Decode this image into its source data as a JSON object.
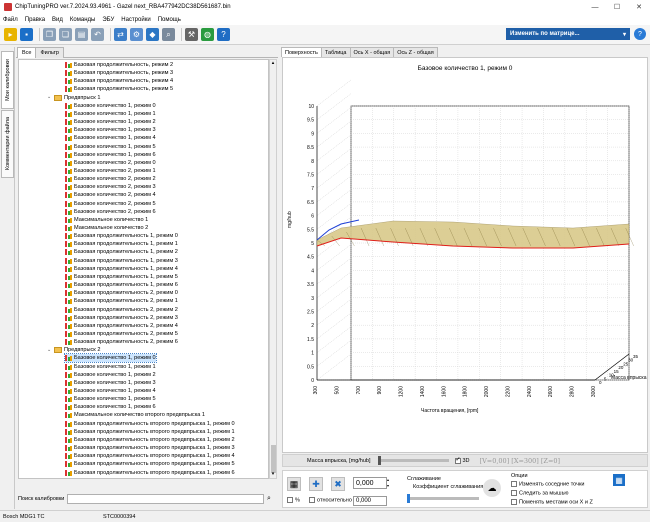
{
  "window": {
    "title": "ChipTuningPRO ver.7.2024.93.4961 - Gazel next_RBA477942DC38D561687.bin",
    "minimize": "—",
    "maximize": "☐",
    "close": "✕"
  },
  "menu": [
    "Файл",
    "Правка",
    "Вид",
    "Команды",
    "ЭБУ",
    "Настройки",
    "Помощь"
  ],
  "toolbar": {
    "matrix_button": "Изменить по матрице...",
    "help": "?"
  },
  "side_tabs": [
    "Мои калибровки",
    "Комментарии файла"
  ],
  "left_tabs": [
    "Все",
    "Фильтр"
  ],
  "tree": [
    {
      "type": "item",
      "indent": 2,
      "label": "Базовая продолжительность, режим 2"
    },
    {
      "type": "item",
      "indent": 2,
      "label": "Базовая продолжительность, режим 3"
    },
    {
      "type": "item",
      "indent": 2,
      "label": "Базовая продолжительность, режим 4"
    },
    {
      "type": "item",
      "indent": 2,
      "label": "Базовая продолжительность, режим 5"
    },
    {
      "type": "folder",
      "indent": 1,
      "label": "Предвпрыск 1"
    },
    {
      "type": "item",
      "indent": 2,
      "label": "Базовое количество 1, режим 0"
    },
    {
      "type": "item",
      "indent": 2,
      "label": "Базовое количество 1, режим 1"
    },
    {
      "type": "item",
      "indent": 2,
      "label": "Базовое количество 1, режим 2"
    },
    {
      "type": "item",
      "indent": 2,
      "label": "Базовое количество 1, режим 3"
    },
    {
      "type": "item",
      "indent": 2,
      "label": "Базовое количество 1, режим 4"
    },
    {
      "type": "item",
      "indent": 2,
      "label": "Базовое количество 1, режим 5"
    },
    {
      "type": "item",
      "indent": 2,
      "label": "Базовое количество 1, режим 6"
    },
    {
      "type": "item",
      "indent": 2,
      "label": "Базовое количество 2, режим 0"
    },
    {
      "type": "item",
      "indent": 2,
      "label": "Базовое количество 2, режим 1"
    },
    {
      "type": "item",
      "indent": 2,
      "label": "Базовое количество 2, режим 2"
    },
    {
      "type": "item",
      "indent": 2,
      "label": "Базовое количество 2, режим 3"
    },
    {
      "type": "item",
      "indent": 2,
      "label": "Базовое количество 2, режим 4"
    },
    {
      "type": "item",
      "indent": 2,
      "label": "Базовое количество 2, режим 5"
    },
    {
      "type": "item",
      "indent": 2,
      "label": "Базовое количество 2, режим 6"
    },
    {
      "type": "item",
      "indent": 2,
      "label": "Максимальное количество 1"
    },
    {
      "type": "item",
      "indent": 2,
      "label": "Максимальное количество 2"
    },
    {
      "type": "item",
      "indent": 2,
      "label": "Базовая продолжительность 1, режим 0"
    },
    {
      "type": "item",
      "indent": 2,
      "label": "Базовая продолжительность 1, режим 1"
    },
    {
      "type": "item",
      "indent": 2,
      "label": "Базовая продолжительность 1, режим 2"
    },
    {
      "type": "item",
      "indent": 2,
      "label": "Базовая продолжительность 1, режим 3"
    },
    {
      "type": "item",
      "indent": 2,
      "label": "Базовая продолжительность 1, режим 4"
    },
    {
      "type": "item",
      "indent": 2,
      "label": "Базовая продолжительность 1, режим 5"
    },
    {
      "type": "item",
      "indent": 2,
      "label": "Базовая продолжительность 1, режим 6"
    },
    {
      "type": "item",
      "indent": 2,
      "label": "Базовая продолжительность 2, режим 0"
    },
    {
      "type": "item",
      "indent": 2,
      "label": "Базовая продолжительность 2, режим 1"
    },
    {
      "type": "item",
      "indent": 2,
      "label": "Базовая продолжительность 2, режим 2"
    },
    {
      "type": "item",
      "indent": 2,
      "label": "Базовая продолжительность 2, режим 3"
    },
    {
      "type": "item",
      "indent": 2,
      "label": "Базовая продолжительность 2, режим 4"
    },
    {
      "type": "item",
      "indent": 2,
      "label": "Базовая продолжительность 2, режим 5"
    },
    {
      "type": "item",
      "indent": 2,
      "label": "Базовая продолжительность 2, режим 6"
    },
    {
      "type": "folder",
      "indent": 1,
      "label": "Предвпрыск 2"
    },
    {
      "type": "item",
      "indent": 2,
      "label": "Базовое количество 1, режим 0",
      "selected": true
    },
    {
      "type": "item",
      "indent": 2,
      "label": "Базовое количество 1, режим 1"
    },
    {
      "type": "item",
      "indent": 2,
      "label": "Базовое количество 1, режим 2"
    },
    {
      "type": "item",
      "indent": 2,
      "label": "Базовое количество 1, режим 3"
    },
    {
      "type": "item",
      "indent": 2,
      "label": "Базовое количество 1, режим 4"
    },
    {
      "type": "item",
      "indent": 2,
      "label": "Базовое количество 1, режим 5"
    },
    {
      "type": "item",
      "indent": 2,
      "label": "Базовое количество 1, режим 6"
    },
    {
      "type": "item",
      "indent": 2,
      "label": "Максимальное количество второго предвпрыска 1"
    },
    {
      "type": "item",
      "indent": 2,
      "label": "Базовая продолжительность второго предвпрыска 1, режим 0"
    },
    {
      "type": "item",
      "indent": 2,
      "label": "Базовая продолжительность второго предвпрыска 1, режим 1"
    },
    {
      "type": "item",
      "indent": 2,
      "label": "Базовая продолжительность второго предвпрыска 1, режим 2"
    },
    {
      "type": "item",
      "indent": 2,
      "label": "Базовая продолжительность второго предвпрыска 1, режим 3"
    },
    {
      "type": "item",
      "indent": 2,
      "label": "Базовая продолжительность второго предвпрыска 1, режим 4"
    },
    {
      "type": "item",
      "indent": 2,
      "label": "Базовая продолжительность второго предвпрыска 1, режим 5"
    },
    {
      "type": "item",
      "indent": 2,
      "label": "Базовая продолжительность второго предвпрыска 1, режим 6"
    }
  ],
  "search": {
    "label": "Поиск калибровки",
    "value": ""
  },
  "right_tabs": [
    "Поверхность",
    "Таблица",
    "Ось X - общая",
    "Ось Z - общая"
  ],
  "chart": {
    "title": "Базовое количество 1, режим 0",
    "ylabel": "mg/hub",
    "xlabel": "Частота вращения, [rpm]",
    "zlabel": "Масса впрыска",
    "yticks": [
      "10",
      "9.5",
      "9",
      "8.5",
      "8",
      "7.5",
      "7",
      "6.5",
      "6",
      "5.5",
      "5",
      "4.5",
      "4",
      "3.5",
      "3",
      "2.5",
      "2",
      "1.5",
      "1",
      "0.5",
      "0"
    ],
    "xticks": [
      "300",
      "500",
      "700",
      "900",
      "1200",
      "1400",
      "1600",
      "1800",
      "2000",
      "2200",
      "2400",
      "2600",
      "2800",
      "3000"
    ],
    "zticks": [
      "0",
      "5",
      "10",
      "15",
      "20",
      "25",
      "30",
      "35"
    ]
  },
  "slider": {
    "label": "Масса впрыска, [mg/hub]",
    "check3d": "3D",
    "readout": "[V=0,00] [X=300] [Z=0]"
  },
  "bottom": {
    "value1": "0,000",
    "value2": "0,000",
    "percent": "%",
    "relative": "относительно",
    "smoothing_label": "Сглаживание",
    "smoothing_coef": "Коэффициент сглаживания",
    "options_label": "Опции",
    "opt1": "Изменять соседние точки",
    "opt2": "Следить за мышью",
    "opt3": "Поменять местами оси X и Z"
  },
  "status": {
    "ecu": "Bosch MDG1 TC",
    "code": "STC0000394"
  },
  "colors": {
    "accent": "#1f5fa8",
    "selection": "#cde6ff",
    "surface": "#d9c98a",
    "edge_red": "#e0201b",
    "edge_blue": "#1d3fd6"
  }
}
